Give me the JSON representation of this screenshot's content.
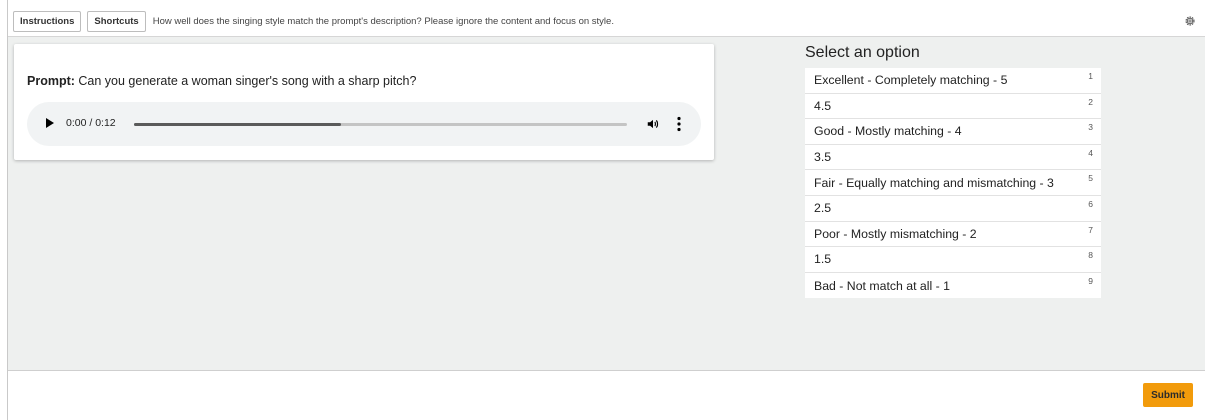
{
  "toolbar": {
    "instructions_label": "Instructions",
    "shortcuts_label": "Shortcuts",
    "question": "How well does the singing style match the prompt's description? Please ignore the content and focus on style."
  },
  "prompt": {
    "label": "Prompt:",
    "text": "Can you generate a woman singer's song with a sharp pitch?"
  },
  "player": {
    "time": "0:00 / 0:12",
    "progress_fraction": 0.42
  },
  "select": {
    "title": "Select an option",
    "options": [
      {
        "label": "Excellent - Completely matching - 5",
        "key": "1"
      },
      {
        "label": "4.5",
        "key": "2"
      },
      {
        "label": "Good - Mostly matching - 4",
        "key": "3"
      },
      {
        "label": "3.5",
        "key": "4"
      },
      {
        "label": "Fair - Equally matching and mismatching - 3",
        "key": "5"
      },
      {
        "label": "2.5",
        "key": "6"
      },
      {
        "label": "Poor - Mostly mismatching - 2",
        "key": "7"
      },
      {
        "label": "1.5",
        "key": "8"
      },
      {
        "label": "Bad - Not match at all - 1",
        "key": "9"
      }
    ]
  },
  "footer": {
    "submit_label": "Submit"
  },
  "colors": {
    "accent": "#f29b0b",
    "workarea_bg": "#eef0ef"
  },
  "icons": [
    "gear-icon",
    "play-icon",
    "volume-icon",
    "more-vert-icon"
  ]
}
